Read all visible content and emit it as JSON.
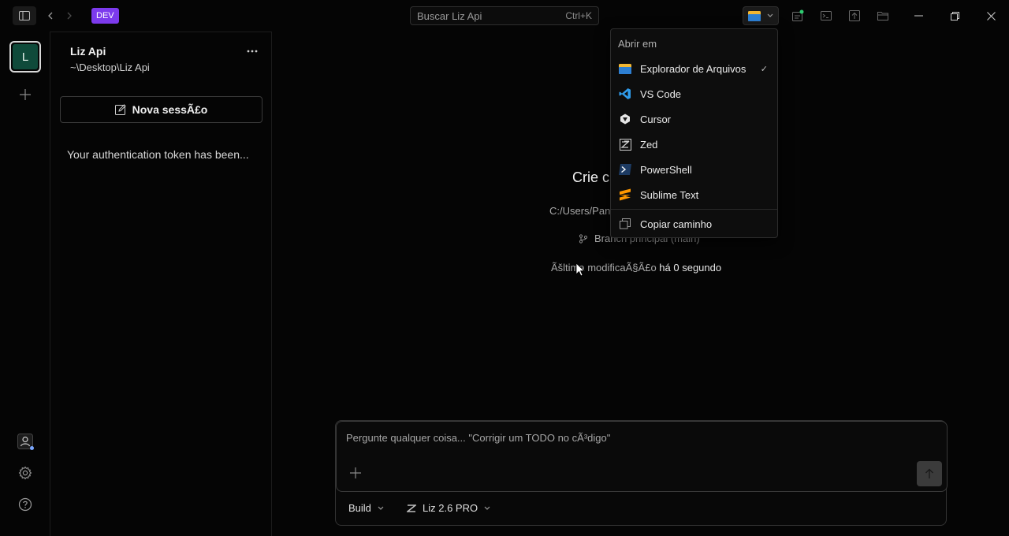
{
  "titlebar": {
    "dev_badge": "DEV",
    "search_placeholder": "Buscar Liz Api",
    "search_shortcut": "Ctrl+K"
  },
  "rail": {
    "workspace_initial": "L"
  },
  "sidebar": {
    "project_name": "Liz Api",
    "project_path": "~\\Desktop\\Liz Api",
    "new_session_label": "Nova sessÃ£o",
    "sessions": [
      "Your authentication token has been..."
    ]
  },
  "main": {
    "heading_partial": "Crie c",
    "path_partial": "C:/Users/Pan",
    "branch_text": "Branch principal (main)",
    "last_modified_prefix": "Ãšltima modificaÃ§Ã£o",
    "last_modified_value": "há 0 segundo"
  },
  "composer": {
    "placeholder": "Pergunte qualquer coisa... \"Corrigir um TODO no cÃ³digo\"",
    "mode_label": "Build",
    "model_label": "Liz 2.6 PRO"
  },
  "open_in_menu": {
    "header": "Abrir em",
    "items": [
      {
        "label": "Explorador de Arquivos",
        "icon": "folder-icon",
        "checked": true
      },
      {
        "label": "VS Code",
        "icon": "vscode-icon"
      },
      {
        "label": "Cursor",
        "icon": "cursor-icon"
      },
      {
        "label": "Zed",
        "icon": "zed-icon"
      },
      {
        "label": "PowerShell",
        "icon": "powershell-icon"
      },
      {
        "label": "Sublime Text",
        "icon": "sublime-icon"
      }
    ],
    "copy_path_label": "Copiar caminho",
    "check_mark": "✓"
  },
  "colors": {
    "accent": "#7c3aed",
    "workspace_avatar": "#0f4a3a",
    "background": "#050505"
  }
}
